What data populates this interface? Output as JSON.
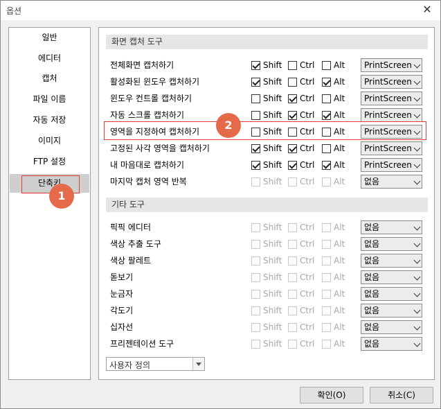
{
  "window": {
    "title": "옵션"
  },
  "sidebar": {
    "items": [
      {
        "label": "일반"
      },
      {
        "label": "에디터"
      },
      {
        "label": "캡처"
      },
      {
        "label": "파일 이름"
      },
      {
        "label": "자동 저장"
      },
      {
        "label": "이미지"
      },
      {
        "label": "FTP 설정"
      },
      {
        "label": "단축키",
        "selected": true
      }
    ]
  },
  "sections": {
    "capture_title": "화면 캡처 도구",
    "other_title": "기타 도구"
  },
  "capture_rows": [
    {
      "label": "전체화면 캡처하기",
      "shift": true,
      "ctrl": false,
      "alt": false,
      "key": "PrintScreen",
      "enabled": true
    },
    {
      "label": "활성화된 윈도우 캡처하기",
      "shift": true,
      "ctrl": false,
      "alt": true,
      "key": "PrintScreen",
      "enabled": true
    },
    {
      "label": "윈도우 컨트롤 캡처하기",
      "shift": false,
      "ctrl": true,
      "alt": false,
      "key": "PrintScreen",
      "enabled": true
    },
    {
      "label": "자동 스크롤 캡처하기",
      "shift": false,
      "ctrl": true,
      "alt": true,
      "key": "PrintScreen",
      "enabled": true
    },
    {
      "label": "영역을 지정하여 캡처하기",
      "shift": false,
      "ctrl": false,
      "alt": false,
      "key": "PrintScreen",
      "enabled": true
    },
    {
      "label": "고정된 사각 영역을 캡처하기",
      "shift": true,
      "ctrl": true,
      "alt": false,
      "key": "PrintScreen",
      "enabled": true
    },
    {
      "label": "내 마음대로 캡처하기",
      "shift": true,
      "ctrl": true,
      "alt": true,
      "key": "PrintScreen",
      "enabled": true
    },
    {
      "label": "마지막 캡처 영역 반복",
      "shift": false,
      "ctrl": false,
      "alt": false,
      "key": "없음",
      "enabled": false
    }
  ],
  "other_rows": [
    {
      "label": "픽픽 에디터",
      "key": "없음"
    },
    {
      "label": "색상 추출 도구",
      "key": "없음"
    },
    {
      "label": "색상 팔레트",
      "key": "없음"
    },
    {
      "label": "돋보기",
      "key": "없음"
    },
    {
      "label": "눈금자",
      "key": "없음"
    },
    {
      "label": "각도기",
      "key": "없음"
    },
    {
      "label": "십자선",
      "key": "없음"
    },
    {
      "label": "프리젠테이션 도구",
      "key": "없음"
    }
  ],
  "modifiers": {
    "shift": "Shift",
    "ctrl": "Ctrl",
    "alt": "Alt"
  },
  "preset": {
    "value": "사용자 정의"
  },
  "buttons": {
    "ok": "확인(O)",
    "cancel": "취소(C)"
  },
  "annotations": {
    "badge1": "1",
    "badge2": "2"
  },
  "colors": {
    "highlight": "#e53935",
    "badge": "#e46a4a"
  }
}
